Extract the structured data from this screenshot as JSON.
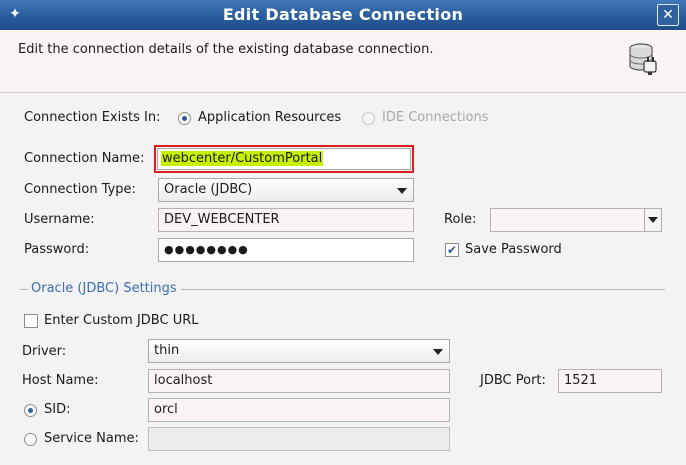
{
  "window": {
    "title": "Edit Database Connection",
    "close_label": "✕",
    "system_icon": "✦"
  },
  "header": {
    "description": "Edit the connection details of the existing database connection."
  },
  "connection_exists_in": {
    "label": "Connection Exists In:",
    "options": [
      {
        "label": "Application Resources",
        "selected": true,
        "enabled": true
      },
      {
        "label": "IDE Connections",
        "selected": false,
        "enabled": false
      }
    ]
  },
  "connection_name": {
    "label": "Connection Name:",
    "value": "webcenter/CustomPortal"
  },
  "connection_type": {
    "label": "Connection Type:",
    "value": "Oracle (JDBC)"
  },
  "username": {
    "label": "Username:",
    "value": "DEV_WEBCENTER"
  },
  "password": {
    "label": "Password:",
    "value": "●●●●●●●●"
  },
  "role": {
    "label": "Role:",
    "value": ""
  },
  "save_password": {
    "label": "Save Password",
    "checked": true
  },
  "settings": {
    "title": "Oracle (JDBC) Settings",
    "custom_url": {
      "label": "Enter Custom JDBC URL",
      "checked": false
    },
    "driver": {
      "label": "Driver:",
      "value": "thin"
    },
    "host": {
      "label": "Host Name:",
      "value": "localhost"
    },
    "port": {
      "label": "JDBC Port:",
      "value": "1521"
    },
    "sid": {
      "label": "SID:",
      "value": "orcl",
      "selected": true
    },
    "service_name": {
      "label": "Service Name:",
      "value": "",
      "selected": false
    }
  },
  "colors": {
    "titlebar": "#2a5d9c",
    "accent": "#2b5f9f",
    "highlight": "#c7f000",
    "error_border": "#d71f1f"
  }
}
